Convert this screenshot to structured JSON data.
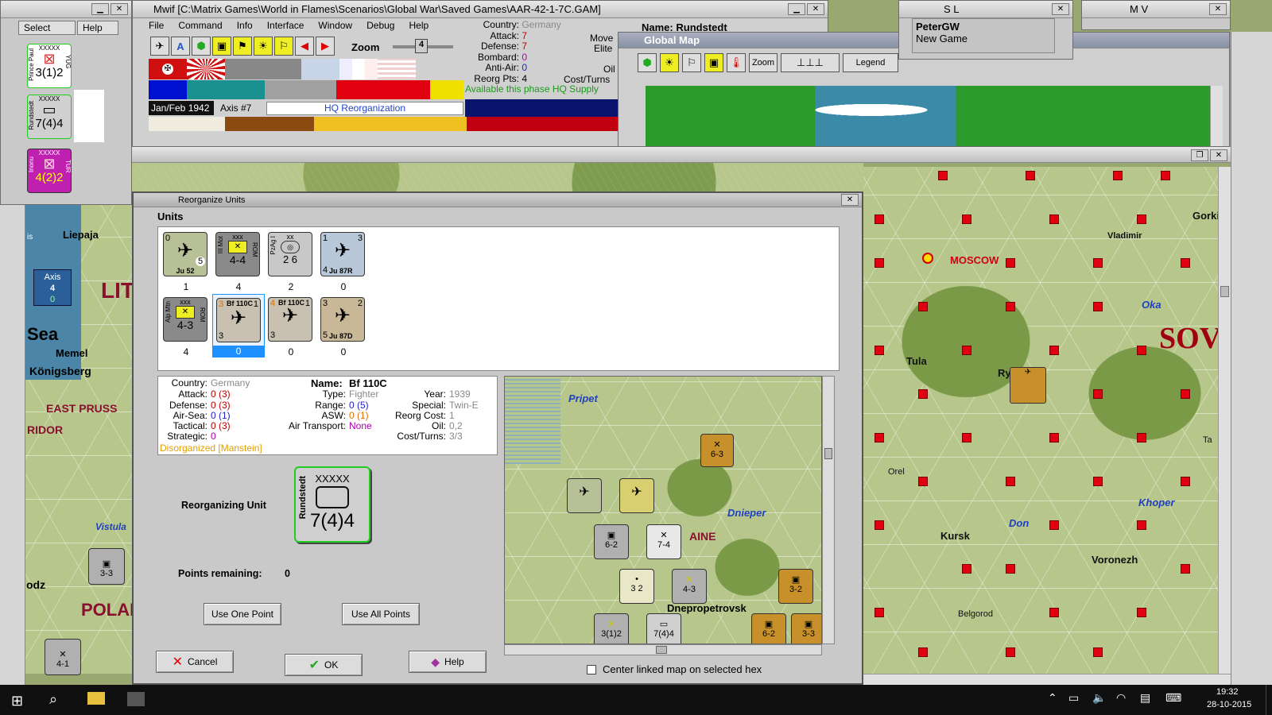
{
  "main_window": {
    "title": "Mwif [C:\\Matrix Games\\World in Flames\\Scenarios\\Global War\\Saved Games\\AAR-42-1-7C.GAM]",
    "menu": [
      "File",
      "Command",
      "Info",
      "Interface",
      "Window",
      "Debug",
      "Help"
    ],
    "zoom_label": "Zoom",
    "zoom_value": "4",
    "date": "Jan/Feb 1942",
    "turn_side": "Axis #7",
    "phase": "HQ Reorganization"
  },
  "select_window": {
    "tabs": [
      "Select",
      "Help"
    ],
    "units": [
      {
        "name": "Prince Paul",
        "size": "XXXXX",
        "strength": "3(1)2",
        "tag": "YUG"
      },
      {
        "name": "Rundstedt",
        "size": "XXXXX",
        "strength": "7(4)4"
      },
      {
        "name": "Inonu",
        "size": "XXXXX",
        "strength": "4(2)2",
        "tag": "TUR"
      }
    ]
  },
  "info_panel": {
    "country_label": "Country:",
    "country": "Germany",
    "attack_label": "Attack:",
    "attack": "7",
    "defense_label": "Defense:",
    "defense": "7",
    "bombard_label": "Bombard:",
    "bombard": "0",
    "antiair_label": "Anti-Air:",
    "antiair": "0",
    "reorg_label": "Reorg Pts:",
    "reorg": "4",
    "available": "Available this phase HQ Supply",
    "name_label": "Name:",
    "name": "Rundstedt",
    "move_label": "Move",
    "elite_label": "Elite",
    "oil_label": "Oil",
    "cost_label": "Cost/Turns"
  },
  "global_map": {
    "title": "Global Map",
    "zoom_label": "Zoom",
    "legend_label": "Legend"
  },
  "players": [
    {
      "code": "S L"
    },
    {
      "code": "M V"
    },
    {
      "name": "PeterGW",
      "status": "New Game"
    }
  ],
  "dialog": {
    "title": "Reorganize Units",
    "units_header": "Units",
    "units": [
      {
        "name": "Ju 52",
        "left": "0",
        "right": "5",
        "count": "1",
        "type": "air",
        "color": "#b8c098"
      },
      {
        "name": "III Mot",
        "size": "xxx",
        "strength": "4-4",
        "tag": "ROM",
        "count": "4",
        "type": "mot",
        "color": "#8a8a8a"
      },
      {
        "name": "PzAg I",
        "size": "xx",
        "strength": "2 6",
        "count": "2",
        "type": "armor",
        "color": "#c8c8c8"
      },
      {
        "name": "Ju 87R",
        "left": "1",
        "right": "3",
        "bottom": "4",
        "count": "0",
        "type": "air",
        "color": "#b8c8d8"
      },
      {
        "name": "Alp Mtn",
        "size": "xxx",
        "strength": "4-3",
        "tag": "ROM",
        "count": "4",
        "type": "mtn",
        "color": "#8a8a8a"
      },
      {
        "name": "Bf 110C",
        "left": "3",
        "right": "1",
        "bottom": "3",
        "count": "0",
        "type": "air",
        "selected": true,
        "color": "#c8c0b0"
      },
      {
        "name": "Bf 110C",
        "left": "4",
        "right": "1",
        "bottom": "3",
        "count": "0",
        "type": "air",
        "color": "#c8c0b0"
      },
      {
        "name": "Ju 87D",
        "left": "3",
        "right": "2",
        "bottom": "5",
        "count": "0",
        "type": "air",
        "color": "#c8b898"
      }
    ],
    "details": {
      "country_label": "Country:",
      "country": "Germany",
      "attack_label": "Attack:",
      "attack": "0 (3)",
      "defense_label": "Defense:",
      "defense": "0 (3)",
      "airsea_label": "Air-Sea:",
      "airsea": "0 (1)",
      "tactical_label": "Tactical:",
      "tactical": "0 (3)",
      "strategic_label": "Strategic:",
      "strategic": "0",
      "status": "Disorganized [Manstein]",
      "name_label": "Name:",
      "name": "Bf 110C",
      "type_label": "Type:",
      "type": "Fighter",
      "range_label": "Range:",
      "range": "0 (5)",
      "asw_label": "ASW:",
      "asw": "0 (1)",
      "airtransport_label": "Air Transport:",
      "airtransport": "None",
      "year_label": "Year:",
      "year": "1939",
      "special_label": "Special:",
      "special": "Twin-E",
      "reorgcost_label": "Reorg Cost:",
      "reorgcost": "1",
      "oil_label": "Oil:",
      "oil": "0,2",
      "costturns_label": "Cost/Turns:",
      "costturns": "3/3"
    },
    "reorg_unit_label": "Reorganizing Unit",
    "reorg_unit": {
      "name": "Rundstedt",
      "size": "XXXXX",
      "strength": "7(4)4"
    },
    "points_label": "Points remaining:",
    "points": "0",
    "use_one": "Use One Point",
    "use_all": "Use All Points",
    "cancel": "Cancel",
    "ok": "OK",
    "help": "Help",
    "center_linked": "Center linked map on selected hex",
    "minimap": {
      "rivers": [
        "Pripet",
        "Dnieper"
      ],
      "labels": [
        "AINE",
        "Dnepropetrovsk"
      ],
      "counters": [
        "6-3",
        "6-2",
        "7-4",
        "3 2",
        "4-3",
        "3-2",
        "3(1)2",
        "7(4)4",
        "6-2",
        "3-3"
      ]
    }
  },
  "main_map": {
    "cities": [
      "Gorki",
      "Vladimir",
      "MOSCOW",
      "Tula",
      "Orel",
      "Kursk",
      "Voronezh",
      "Belgorod",
      "Ry",
      "Ta"
    ],
    "rivers": [
      "Oka",
      "Khoper",
      "Don"
    ],
    "region": "SOV"
  },
  "left_map": {
    "places": [
      "Liepaja",
      "Memel",
      "Königsberg",
      "EAST PRUSS",
      "RIDOR",
      "POLAN",
      "Vistula",
      "Sea",
      "LIT",
      "odz",
      "is"
    ],
    "axis_label": "Axis",
    "axis_value": "4",
    "axis_sub": "0",
    "counters": [
      "3-3",
      "4-1"
    ]
  },
  "taskbar": {
    "time": "19:32",
    "date": "28-10-2015"
  }
}
